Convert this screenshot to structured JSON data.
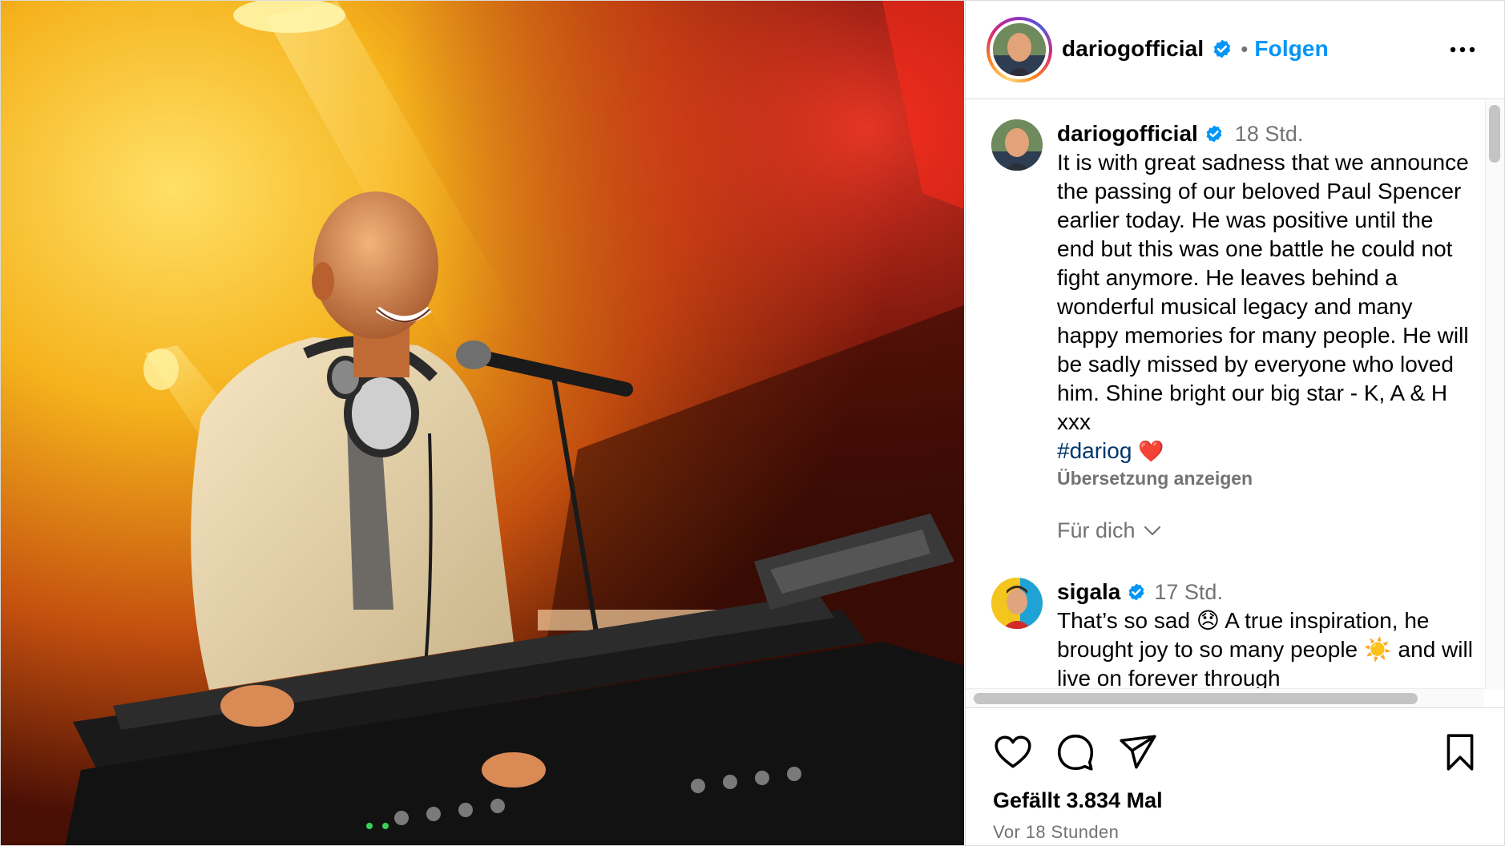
{
  "post": {
    "author": {
      "username": "dariogofficial",
      "verified": true,
      "avatar_icon": "avatar-dariog"
    },
    "header": {
      "separator": "•",
      "follow_label": "Folgen",
      "more_icon": "more-horizontal-icon"
    },
    "caption": {
      "username": "dariogofficial",
      "time": "18 Std.",
      "text": "It is with great sadness that we announce the passing of our beloved Paul Spencer earlier today. He was positive until the end but this was one battle he could not fight anymore. He leaves behind a wonderful musical legacy and many happy memories for many people. He will be sadly missed by everyone who loved him. Shine bright our big star - K, A & H xxx",
      "hashtag": "#dariog",
      "heart": "❤️",
      "translate_label": "Übersetzung anzeigen"
    },
    "for_you_label": "Für dich",
    "comments": [
      {
        "username": "sigala",
        "verified": true,
        "time": "17 Std.",
        "text": "That’s so sad 😞 A true inspiration, he brought joy to so many people ☀️ and will live on forever through"
      }
    ],
    "actions": {
      "like_icon": "heart-icon",
      "comment_icon": "comment-icon",
      "share_icon": "paper-plane-icon",
      "save_icon": "bookmark-icon"
    },
    "likes_text": "Gefällt 3.834 Mal",
    "posted_ago": "Vor 18 Stunden"
  },
  "colors": {
    "link_blue": "#0095f6",
    "verified_blue": "#0095f6",
    "hashtag_blue": "#00376b",
    "muted_gray": "#737373",
    "border": "#dbdbdb"
  }
}
